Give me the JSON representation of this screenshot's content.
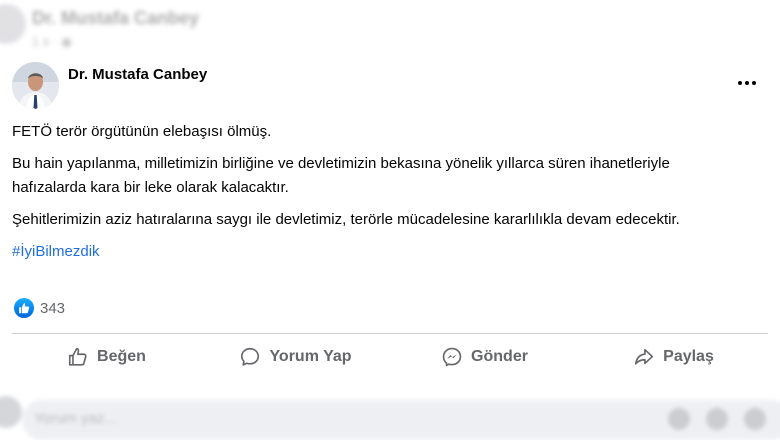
{
  "previous_post": {
    "author": "Dr. Mustafa Canbey",
    "meta": "1 s · ◉"
  },
  "post": {
    "author": "Dr. Mustafa Canbey",
    "more_label": "•••",
    "paragraphs": [
      "FETÖ terör örgütünün elebaşısı ölmüş.",
      "Bu hain yapılanma, milletimizin birliğine ve devletimizin bekasına yönelik yıllarca süren ihanetleriyle hafızalarda kara bir leke olarak kalacaktır.",
      "Şehitlerimizin aziz hatıralarına saygı ile devletimiz, terörle mücadelesine kararlılıkla devam edecektir."
    ],
    "hashtag": "#İyiBilmezdik",
    "reaction_count": "343"
  },
  "actions": {
    "like": "Beğen",
    "comment": "Yorum Yap",
    "send": "Gönder",
    "share": "Paylaş"
  },
  "composer": {
    "placeholder": "Yorum yaz..."
  },
  "colors": {
    "link": "#216fdb",
    "secondary_text": "#65676b",
    "like_blue": "#0866ff",
    "divider": "#ced0d4"
  },
  "icons": [
    "more-icon",
    "thumbs-up-icon",
    "comment-bubble-icon",
    "messenger-icon",
    "share-arrow-icon",
    "like-reaction-icon"
  ]
}
